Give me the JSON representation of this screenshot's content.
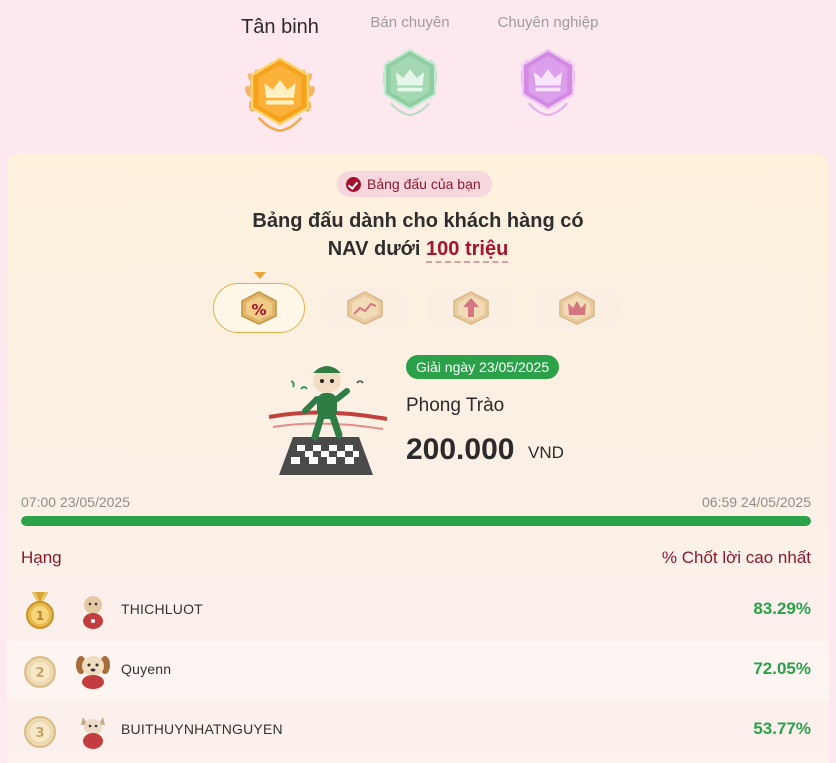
{
  "tiers": [
    {
      "label": "Tân binh",
      "state": "active",
      "color": "#f5a623"
    },
    {
      "label": "Bán chuyên",
      "state": "inactive",
      "color": "#8fd1a3"
    },
    {
      "label": "Chuyên nghiệp",
      "state": "inactive",
      "color": "#d48be0"
    }
  ],
  "board": {
    "your_board_label": "Bảng đấu của bạn",
    "headline_line1": "Bảng đấu dành cho khách hàng có",
    "headline_line2_prefix": "NAV dưới",
    "headline_highlight": "100 triệu"
  },
  "tabs": [
    {
      "icon": "percent-icon",
      "active": true
    },
    {
      "icon": "trend-chart-icon",
      "active": false
    },
    {
      "icon": "arrow-up-icon",
      "active": false
    },
    {
      "icon": "crown-icon",
      "active": false
    }
  ],
  "prize": {
    "date_label": "Giải ngày 23/05/2025",
    "name": "Phong Trào",
    "amount": "200.000",
    "currency": "VND"
  },
  "period": {
    "start": "07:00 23/05/2025",
    "end": "06:59 24/05/2025",
    "progress_fraction": 1.0
  },
  "leaderboard": {
    "rank_header": "Hạng",
    "metric_header": "% Chốt lời cao nhất",
    "rows": [
      {
        "rank": 1,
        "name": "THICHLUOT",
        "value": "83.29%"
      },
      {
        "rank": 2,
        "name": "Quyenn",
        "value": "72.05%"
      },
      {
        "rank": 3,
        "name": "BUITHUYNHATNGUYEN",
        "value": "53.77%"
      }
    ]
  },
  "colors": {
    "accent_red": "#a3142e",
    "success_green": "#2ba24a",
    "background_pink": "#fde8ef"
  }
}
